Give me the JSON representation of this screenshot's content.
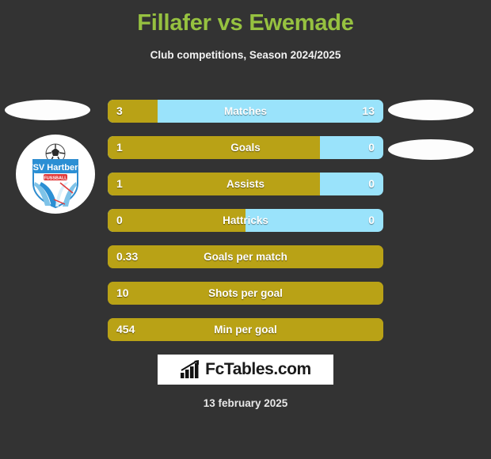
{
  "header": {
    "title": "Fillafer vs Ewemade",
    "subtitle": "Club competitions, Season 2024/2025",
    "title_color": "#96c140"
  },
  "colors": {
    "background": "#333333",
    "home_bar": "#b9a216",
    "away_bar": "#9ae3fb",
    "title": "#96c140",
    "text": "#ffffff"
  },
  "club_badge": {
    "name": "TSV Hartberg",
    "line1": "TSV Hartberg",
    "line2": "FUSSBALL"
  },
  "stats": [
    {
      "label": "Matches",
      "left": "3",
      "right": "13",
      "fill_pct": 18,
      "two_sided": true
    },
    {
      "label": "Goals",
      "left": "1",
      "right": "0",
      "fill_pct": 77,
      "two_sided": true
    },
    {
      "label": "Assists",
      "left": "1",
      "right": "0",
      "fill_pct": 77,
      "two_sided": true
    },
    {
      "label": "Hattricks",
      "left": "0",
      "right": "0",
      "fill_pct": 50,
      "two_sided": true
    },
    {
      "label": "Goals per match",
      "left": "0.33",
      "right": "",
      "fill_pct": 100,
      "two_sided": false
    },
    {
      "label": "Shots per goal",
      "left": "10",
      "right": "",
      "fill_pct": 100,
      "two_sided": false
    },
    {
      "label": "Min per goal",
      "left": "454",
      "right": "",
      "fill_pct": 100,
      "two_sided": false
    }
  ],
  "footer": {
    "logo_text": "FcTables.com",
    "date": "13 february 2025"
  }
}
